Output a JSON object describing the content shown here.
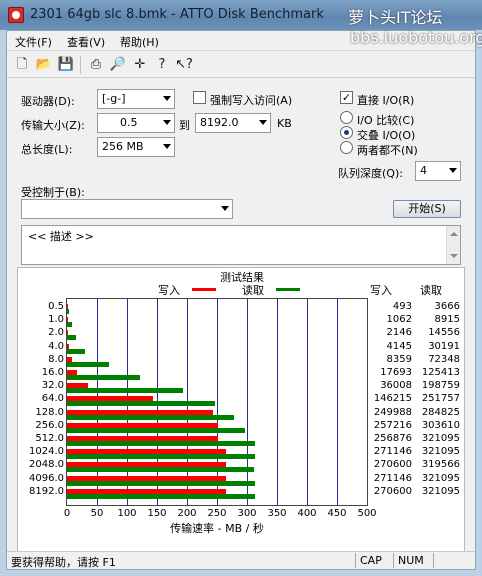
{
  "window": {
    "title": "2301 64gb slc 8.bmk - ATTO Disk Benchmark",
    "watermark_line1": "萝卜头IT论坛",
    "watermark_line2": "bbs.luobotou.org"
  },
  "menu": [
    "文件(F)",
    "查看(V)",
    "帮助(H)"
  ],
  "toolbar": {
    "icons": [
      "new-icon",
      "open-icon",
      "save-icon",
      "print-icon",
      "print-preview-icon",
      "move-icon",
      "help-icon",
      "context-help-icon"
    ]
  },
  "form": {
    "drive_label": "驱动器(D):",
    "drive_value": "[-g-]",
    "force_write_label": "强制写入访问(A)",
    "direct_io_label": "直接 I/O(R)",
    "transfer_label": "传输大小(Z):",
    "transfer_from": "0.5",
    "to_label": "到",
    "transfer_to": "8192.0",
    "kb_label": "KB",
    "total_label": "总长度(L):",
    "total_value": "256 MB",
    "io_compare_label": "I/O 比较(C)",
    "overlapped_io_label": "交叠 I/O(O)",
    "neither_label": "两者都不(N)",
    "queue_label": "队列深度(Q):",
    "queue_value": "4",
    "controlled_by_label": "受控制于(B):",
    "controlled_by_value": "",
    "start_button": "开始(S)",
    "description": "<< 描述 >>"
  },
  "results": {
    "title": "测试结果",
    "legend_write": "写入",
    "legend_read": "读取",
    "col_write": "写入",
    "col_read": "读取",
    "x_axis_title": "传输速率 - MB / 秒"
  },
  "chart_data": {
    "type": "bar",
    "orientation": "horizontal",
    "title": "测试结果",
    "xlabel": "传输速率 - MB / 秒",
    "xlim": [
      0,
      500
    ],
    "xticks": [
      "0",
      "50",
      "100",
      "150",
      "200",
      "250",
      "300",
      "350",
      "400",
      "450",
      "500"
    ],
    "categories": [
      "0.5",
      "1.0",
      "2.0",
      "4.0",
      "8.0",
      "16.0",
      "32.0",
      "64.0",
      "128.0",
      "256.0",
      "512.0",
      "1024.0",
      "2048.0",
      "4096.0",
      "8192.0"
    ],
    "series": [
      {
        "name": "写入",
        "color": "#ff0000",
        "values": [
          493,
          1062,
          2146,
          4145,
          8359,
          17693,
          36008,
          146215,
          249988,
          257216,
          256876,
          271146,
          270600,
          271146,
          270600
        ]
      },
      {
        "name": "读取",
        "color": "#008000",
        "values": [
          3666,
          8915,
          14556,
          30191,
          72348,
          125413,
          198759,
          251757,
          284825,
          303610,
          321095,
          321095,
          319566,
          321095,
          321095
        ]
      }
    ],
    "write_text": [
      "493",
      "1062",
      "2146",
      "4145",
      "8359",
      "17693",
      "36008",
      "146215",
      "249988",
      "257216",
      "256876",
      "271146",
      "270600",
      "271146",
      "270600"
    ],
    "read_text": [
      "3666",
      "8915",
      "14556",
      "30191",
      "72348",
      "125413",
      "198759",
      "251757",
      "284825",
      "303610",
      "321095",
      "321095",
      "319566",
      "321095",
      "321095"
    ],
    "grid": true,
    "legend": "top-center"
  },
  "status": {
    "help_text": "要获得帮助，请按 F1",
    "cap": "CAP",
    "num": "NUM"
  },
  "colors": {
    "write": "#ff0000",
    "read": "#008000",
    "grid": "#2a2a9a"
  }
}
